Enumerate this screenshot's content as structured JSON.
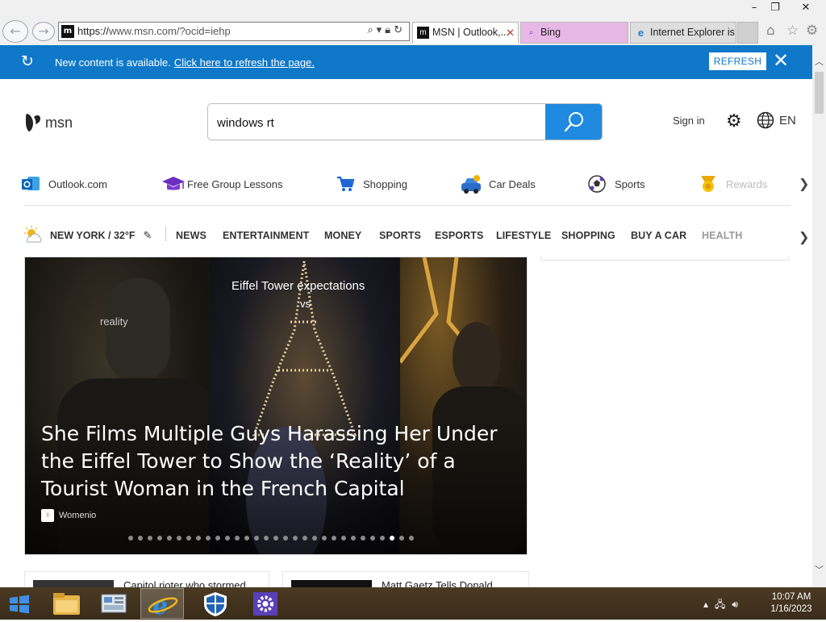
{
  "browser": {
    "url_prefix": "https://",
    "url_host": "www.msn.com",
    "url_rest": "/?ocid=iehp",
    "tabs": [
      {
        "label": "MSN | Outlook,...",
        "icon": "msn-icon",
        "active": true
      },
      {
        "label": "Bing",
        "icon": "search-icon",
        "active": false
      },
      {
        "label": "Internet Explorer is...",
        "icon": "ie-icon",
        "active": false
      }
    ],
    "window_buttons": [
      "–",
      "❐",
      "✕"
    ]
  },
  "notification": {
    "message": "New content is available.",
    "link": "Click here to refresh the page.",
    "button": "REFRESH",
    "color": "#0f78c8"
  },
  "header": {
    "logo_text": "msn",
    "search_value": "windows rt",
    "sign_in": "Sign in",
    "language": "EN",
    "search_button_color": "#1f8ae0"
  },
  "quick_links": [
    {
      "label": "Outlook.com",
      "icon": "outlook-icon"
    },
    {
      "label": "Free Group Lessons",
      "icon": "graduation-cap-icon"
    },
    {
      "label": "Shopping",
      "icon": "shopping-cart-icon"
    },
    {
      "label": "Car Deals",
      "icon": "car-icon"
    },
    {
      "label": "Sports",
      "icon": "soccer-ball-icon"
    },
    {
      "label": "Rewards",
      "icon": "medal-icon"
    }
  ],
  "weather": {
    "text": "NEW YORK / 32°F",
    "icon": "partly-sunny-icon"
  },
  "categories": [
    "NEWS",
    "ENTERTAINMENT",
    "MONEY",
    "SPORTS",
    "ESPORTS",
    "LIFESTYLE",
    "SHOPPING",
    "BUY A CAR",
    "HEALTH"
  ],
  "hero": {
    "headline": "She Films Multiple Guys Harassing Her Under the Eiffel Tower to Show the ‘Reality’ of a Tourist Woman in the French Capital",
    "source": "Womenio",
    "overlay_title": "Eiffel Tower expectations",
    "overlay_vs": "vs",
    "overlay_reality": "reality",
    "dot_count": 30,
    "active_dot": 27
  },
  "cards": [
    {
      "title": "Capitol rioter who stormed"
    },
    {
      "title": "Matt Gaetz Tells Donald"
    }
  ],
  "taskbar": {
    "time": "10:07 AM",
    "date": "1/16/2023"
  }
}
